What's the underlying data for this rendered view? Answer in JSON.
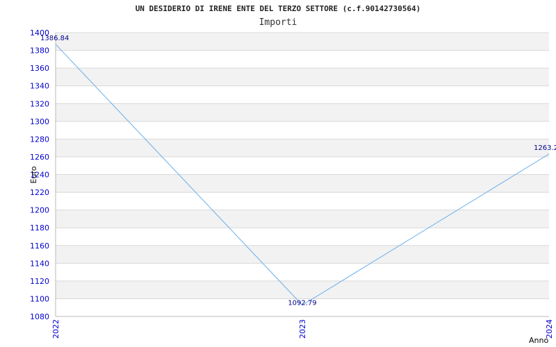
{
  "chart_data": {
    "type": "line",
    "title": "UN DESIDERIO DI IRENE ENTE DEL TERZO SETTORE (c.f.90142730564)",
    "subtitle": "Importi",
    "xlabel": "Anno",
    "ylabel": "Euro",
    "x": [
      "2022",
      "2023",
      "2024"
    ],
    "series": [
      {
        "values": [
          1386.84,
          1092.79,
          1263.2
        ],
        "labels": [
          "1386.84",
          "1092.79",
          "1263.2"
        ]
      }
    ],
    "ylim": [
      1080,
      1400
    ],
    "yticks": [
      1080,
      1100,
      1120,
      1140,
      1160,
      1180,
      1200,
      1220,
      1240,
      1260,
      1280,
      1300,
      1320,
      1340,
      1360,
      1380,
      1400
    ],
    "grid": true,
    "colors": {
      "line": "#6aaeea",
      "band": "#f2f2f2",
      "grid": "#d8d8d8",
      "tick_text": "#0000cc",
      "data_label": "#00008b"
    }
  }
}
